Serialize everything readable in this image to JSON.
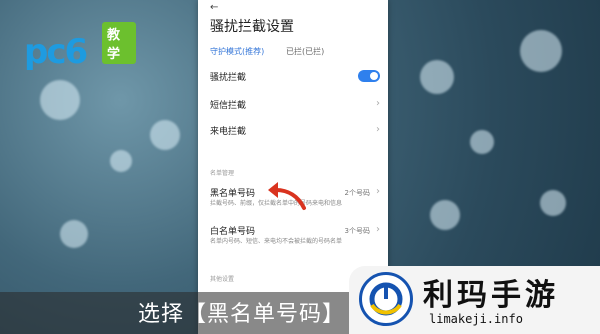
{
  "watermark": {
    "logo_text": "pc6",
    "badge": "教学"
  },
  "screen": {
    "back_icon": "←",
    "title": "骚扰拦截设置",
    "mode_label": "守护模式(推荐)",
    "mode_count": "已拦(已拦)"
  },
  "settings": {
    "items": [
      {
        "label": "骚扰拦截",
        "control": "toggle",
        "enabled": true
      },
      {
        "label": "短信拦截",
        "control": "chevron"
      },
      {
        "label": "来电拦截",
        "control": "chevron"
      }
    ],
    "section_label": "名单管理",
    "list_items": [
      {
        "label": "黑名单号码",
        "desc": "拦截号码、前缀，仅拦截名单中的号码来电和信息",
        "count": "2个号码"
      },
      {
        "label": "白名单号码",
        "desc": "名单内号码、短信、来电均不会被拦截的号码名单",
        "count": "3个号码"
      }
    ],
    "section_label_2": "其他设置"
  },
  "caption": {
    "text": "选择【黑名单号码】"
  },
  "brand": {
    "name": "利玛手游",
    "url": "limakeji.info"
  },
  "colors": {
    "accent": "#2f80ed",
    "arrow": "#d9331f",
    "brand_blue": "#1553b0"
  }
}
